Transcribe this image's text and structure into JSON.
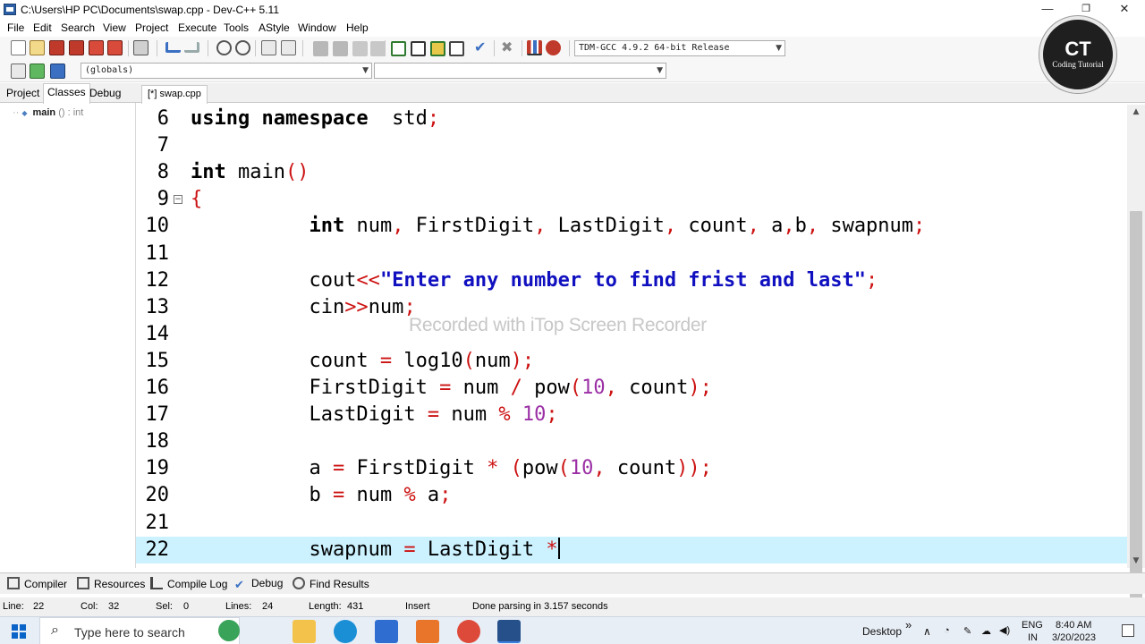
{
  "window": {
    "title": "C:\\Users\\HP PC\\Documents\\swap.cpp - Dev-C++ 5.11",
    "minimize_glyph": "—",
    "restore_glyph": "❐",
    "close_glyph": "✕"
  },
  "menu": {
    "items": [
      "File",
      "Edit",
      "Search",
      "View",
      "Project",
      "Execute",
      "Tools",
      "AStyle",
      "Window",
      "Help"
    ]
  },
  "toolbar": {
    "compiler_select": "TDM-GCC 4.9.2 64-bit Release",
    "scope_select": "(globals)",
    "member_select": ""
  },
  "left_panel": {
    "tabs": [
      "Project",
      "Classes",
      "Debug"
    ],
    "active_tab": "Classes",
    "tree": [
      {
        "name": "main",
        "suffix": " () : int"
      }
    ]
  },
  "editor": {
    "file_tab": "[*] swap.cpp",
    "lines": [
      {
        "number": "6",
        "tokens": [
          [
            "kw",
            "using namespace"
          ],
          [
            "",
            "  std"
          ],
          [
            "op",
            ";"
          ]
        ]
      },
      {
        "number": "7",
        "tokens": []
      },
      {
        "number": "8",
        "tokens": [
          [
            "kw",
            "int"
          ],
          [
            "",
            " main"
          ],
          [
            "op",
            "()"
          ]
        ]
      },
      {
        "number": "9",
        "fold": "−",
        "tokens": [
          [
            "op",
            "{"
          ]
        ]
      },
      {
        "number": "10",
        "tokens": [
          [
            "",
            "          "
          ],
          [
            "kw",
            "int"
          ],
          [
            "",
            " num"
          ],
          [
            "op",
            ","
          ],
          [
            "",
            " FirstDigit"
          ],
          [
            "op",
            ","
          ],
          [
            "",
            " LastDigit"
          ],
          [
            "op",
            ","
          ],
          [
            "",
            " count"
          ],
          [
            "op",
            ","
          ],
          [
            "",
            " a"
          ],
          [
            "op",
            ","
          ],
          [
            "",
            "b"
          ],
          [
            "op",
            ","
          ],
          [
            "",
            " swapnum"
          ],
          [
            "op",
            ";"
          ]
        ]
      },
      {
        "number": "11",
        "tokens": []
      },
      {
        "number": "12",
        "tokens": [
          [
            "",
            "          cout"
          ],
          [
            "op",
            "<<"
          ],
          [
            "str",
            "\"Enter any number to find frist and last\""
          ],
          [
            "op",
            ";"
          ]
        ]
      },
      {
        "number": "13",
        "tokens": [
          [
            "",
            "          cin"
          ],
          [
            "op",
            ">>"
          ],
          [
            "",
            "num"
          ],
          [
            "op",
            ";"
          ]
        ]
      },
      {
        "number": "14",
        "tokens": []
      },
      {
        "number": "15",
        "tokens": [
          [
            "",
            "          count "
          ],
          [
            "op",
            "="
          ],
          [
            "",
            " log10"
          ],
          [
            "op",
            "("
          ],
          [
            "",
            "num"
          ],
          [
            "op",
            ");"
          ]
        ]
      },
      {
        "number": "16",
        "tokens": [
          [
            "",
            "          FirstDigit "
          ],
          [
            "op",
            "="
          ],
          [
            "",
            " num "
          ],
          [
            "op",
            "/"
          ],
          [
            "",
            " pow"
          ],
          [
            "op",
            "("
          ],
          [
            "num",
            "10"
          ],
          [
            "op",
            ","
          ],
          [
            "",
            " count"
          ],
          [
            "op",
            ");"
          ]
        ]
      },
      {
        "number": "17",
        "tokens": [
          [
            "",
            "          LastDigit "
          ],
          [
            "op",
            "="
          ],
          [
            "",
            " num "
          ],
          [
            "op",
            "%"
          ],
          [
            "",
            " "
          ],
          [
            "num",
            "10"
          ],
          [
            "op",
            ";"
          ]
        ]
      },
      {
        "number": "18",
        "tokens": []
      },
      {
        "number": "19",
        "tokens": [
          [
            "",
            "          a "
          ],
          [
            "op",
            "="
          ],
          [
            "",
            " FirstDigit "
          ],
          [
            "op",
            "*"
          ],
          [
            "",
            " "
          ],
          [
            "op",
            "("
          ],
          [
            "",
            "pow"
          ],
          [
            "op",
            "("
          ],
          [
            "num",
            "10"
          ],
          [
            "op",
            ","
          ],
          [
            "",
            " count"
          ],
          [
            "op",
            "));"
          ]
        ]
      },
      {
        "number": "20",
        "tokens": [
          [
            "",
            "          b "
          ],
          [
            "op",
            "="
          ],
          [
            "",
            " num "
          ],
          [
            "op",
            "%"
          ],
          [
            "",
            " a"
          ],
          [
            "op",
            ";"
          ]
        ]
      },
      {
        "number": "21",
        "tokens": []
      },
      {
        "number": "22",
        "current": true,
        "tokens": [
          [
            "",
            "          swapnum "
          ],
          [
            "op",
            "="
          ],
          [
            "",
            " LastDigit "
          ],
          [
            "op",
            "*"
          ]
        ]
      }
    ]
  },
  "watermark": "Recorded with iTop Screen Recorder",
  "logo": {
    "initials": "CT",
    "subtitle": "Coding Tutorial"
  },
  "bottom_tabs": [
    "Compiler",
    "Resources",
    "Compile Log",
    "Debug",
    "Find Results"
  ],
  "status": {
    "line_label": "Line:",
    "line_value": "22",
    "col_label": "Col:",
    "col_value": "32",
    "sel_label": "Sel:",
    "sel_value": "0",
    "lines_label": "Lines:",
    "lines_value": "24",
    "length_label": "Length:",
    "length_value": "431",
    "mode": "Insert",
    "message": "Done parsing in 3.157 seconds"
  },
  "taskbar": {
    "search_placeholder": "Type here to search",
    "desktop_label": "Desktop",
    "chevron": "»",
    "lang_top": "ENG",
    "lang_bottom": "IN",
    "time": "8:40 AM",
    "date": "3/20/2023"
  },
  "colors": {
    "current_line": "#ccf2ff",
    "operator": "#cc1111",
    "string": "#1010c0",
    "number": "#9b2fa5"
  }
}
